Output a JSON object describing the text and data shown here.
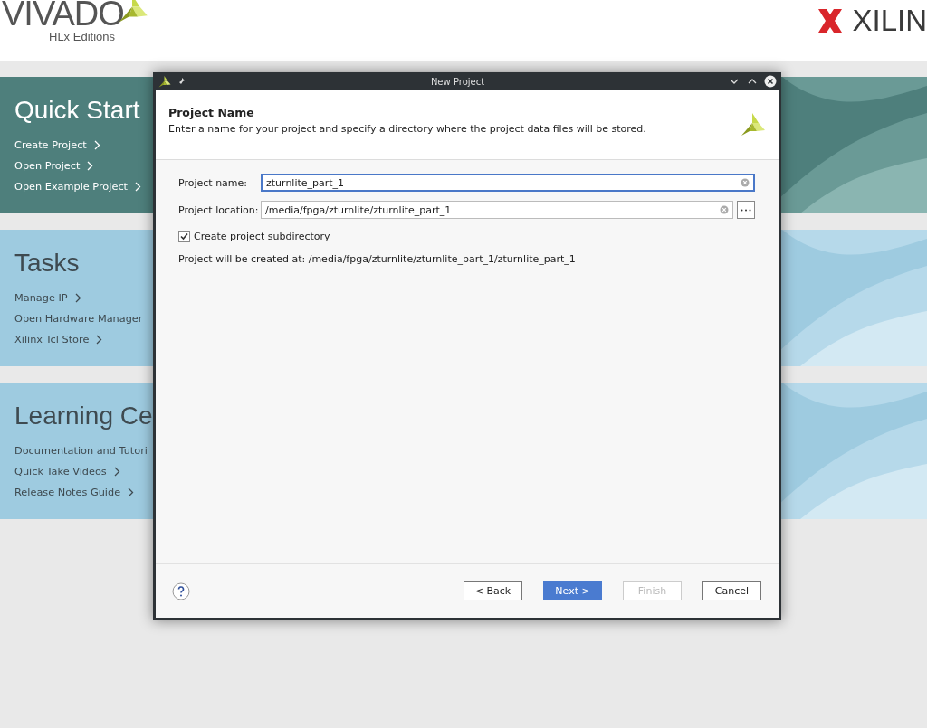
{
  "header": {
    "product": "VIVADO",
    "edition": "HLx Editions",
    "vendor": "XILIN"
  },
  "sections": [
    {
      "title": "Quick Start",
      "kind": "dark",
      "links": [
        {
          "label": "Create Project",
          "arrow": true
        },
        {
          "label": "Open Project",
          "arrow": true
        },
        {
          "label": "Open Example Project",
          "arrow": true
        }
      ]
    },
    {
      "title": "Tasks",
      "kind": "light",
      "links": [
        {
          "label": "Manage IP",
          "arrow": true
        },
        {
          "label": "Open Hardware Manager",
          "arrow": false
        },
        {
          "label": "Xilinx Tcl Store",
          "arrow": true
        }
      ]
    },
    {
      "title": "Learning Ce",
      "kind": "light",
      "links": [
        {
          "label": "Documentation and Tutori",
          "arrow": false
        },
        {
          "label": "Quick Take Videos",
          "arrow": true
        },
        {
          "label": "Release Notes Guide",
          "arrow": true
        }
      ]
    }
  ],
  "dialog": {
    "title": "New Project",
    "page_title": "Project Name",
    "description": "Enter a name for your project and specify a directory where the project data files will be stored.",
    "fields": [
      {
        "label": "Project name:",
        "value": "zturnlite_part_1",
        "focused": true,
        "browse": false
      },
      {
        "label": "Project location:",
        "value": "/media/fpga/zturnlite/zturnlite_part_1",
        "focused": false,
        "browse": true
      }
    ],
    "subdirectory": {
      "label": "Create project subdirectory",
      "checked": true
    },
    "result": "Project will be created at: /media/fpga/zturnlite/zturnlite_part_1/zturnlite_part_1",
    "buttons": [
      {
        "label": "< Back",
        "kind": "default",
        "disabled": false
      },
      {
        "label": "Next >",
        "kind": "primary",
        "disabled": false
      },
      {
        "label": "Finish",
        "kind": "default",
        "disabled": true
      },
      {
        "label": "Cancel",
        "kind": "default",
        "disabled": false
      }
    ]
  }
}
